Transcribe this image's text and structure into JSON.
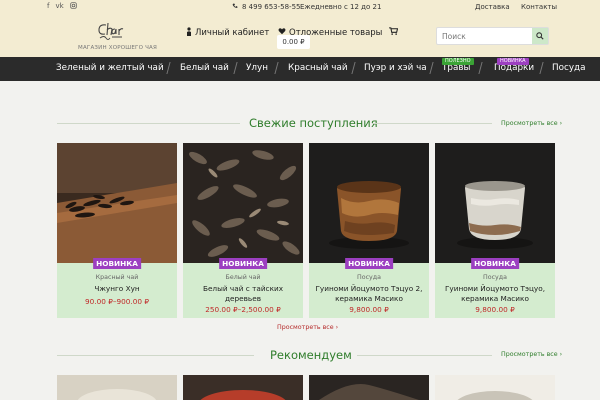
{
  "topbar": {
    "social": [
      "f",
      "vk",
      "ig"
    ],
    "phone": "8 499 653-58-55",
    "hours": "Ежедневно с 12 до 21",
    "links": [
      "Доставка",
      "Контакты"
    ]
  },
  "header": {
    "logo_script": "Chai Ola",
    "logo_tagline": "МАГАЗИН ХОРОШЕГО ЧАЯ",
    "account_label": "Личный кабинет",
    "wishlist_label": "Отложенные товары",
    "cart_total": "0.00 ₽",
    "search_placeholder": "Поиск"
  },
  "nav": {
    "items": [
      {
        "label": "Зеленый и желтый чай"
      },
      {
        "label": "Белый чай"
      },
      {
        "label": "Улун"
      },
      {
        "label": "Красный чай"
      },
      {
        "label": "Пуэр и хэй ча"
      },
      {
        "label": "Травы",
        "badge": "ПОЛЕЗНО",
        "badge_color": "#3aa335"
      },
      {
        "label": "Подарки",
        "badge": "НОВИНКА",
        "badge_color": "#9c3fc1"
      },
      {
        "label": "Посуда"
      }
    ]
  },
  "fresh": {
    "title": "Свежие поступления",
    "view_all": "Просмотреть все",
    "more": "Просмотреть все",
    "products": [
      {
        "badge": "НОВИНКА",
        "category": "Красный чай",
        "name": "Чжунго Хун",
        "price": "90.00 ₽–900.00 ₽",
        "image": "loose-leaf-tea-on-wood"
      },
      {
        "badge": "НОВИНКА",
        "category": "Белый чай",
        "name": "Белый чай с тайских деревьев",
        "price": "250.00 ₽–2,500.00 ₽",
        "image": "white-tea-leaves"
      },
      {
        "badge": "НОВИНКА",
        "category": "Посуда",
        "name": "Гуиноми Йоцумото Тэцуо 2, керамика Масико",
        "price": "9,800.00 ₽",
        "image": "brown-ceramic-cup"
      },
      {
        "badge": "НОВИНКА",
        "category": "Посуда",
        "name": "Гуиноми Йоцумото Тэцуо, керамика Масико",
        "price": "9,800.00 ₽",
        "image": "white-ceramic-cup"
      }
    ]
  },
  "recommended": {
    "title": "Рекомендуем",
    "view_all": "Просмотреть все"
  },
  "colors": {
    "accent_green": "#2f7d2b",
    "card_bg": "#d4eccf",
    "price_red": "#c02a2a",
    "badge_purple": "#9c3fc1",
    "nav_bg": "#2b2b2b",
    "header_bg": "#f3ecd2"
  }
}
